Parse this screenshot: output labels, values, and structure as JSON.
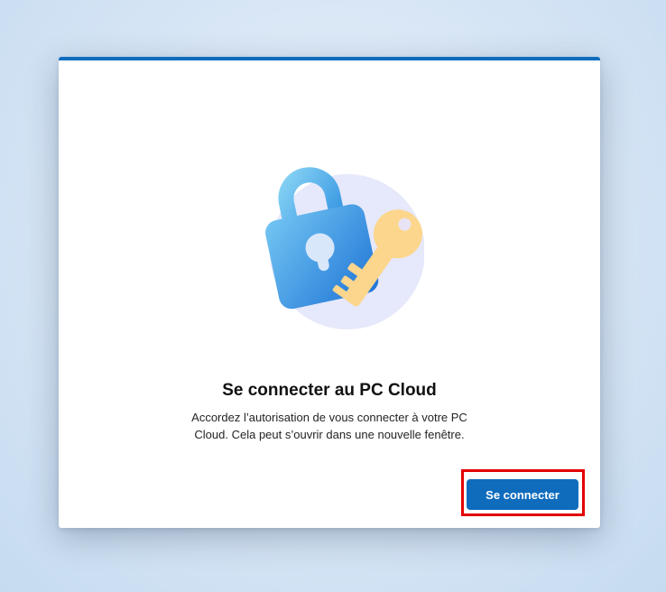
{
  "dialog": {
    "title": "Se connecter au PC Cloud",
    "description": "Accordez l’autorisation de vous connecter à votre PC Cloud. Cela peut s’ouvrir dans une nouvelle fenêtre.",
    "connect_label": "Se connecter",
    "illustration_icon": "lock-key-icon"
  },
  "colors": {
    "accent": "#0f6cbd",
    "highlight": "#e30000",
    "lock": "#2f8fe0",
    "key": "#fcd68c",
    "halo": "#e6e8fb"
  }
}
